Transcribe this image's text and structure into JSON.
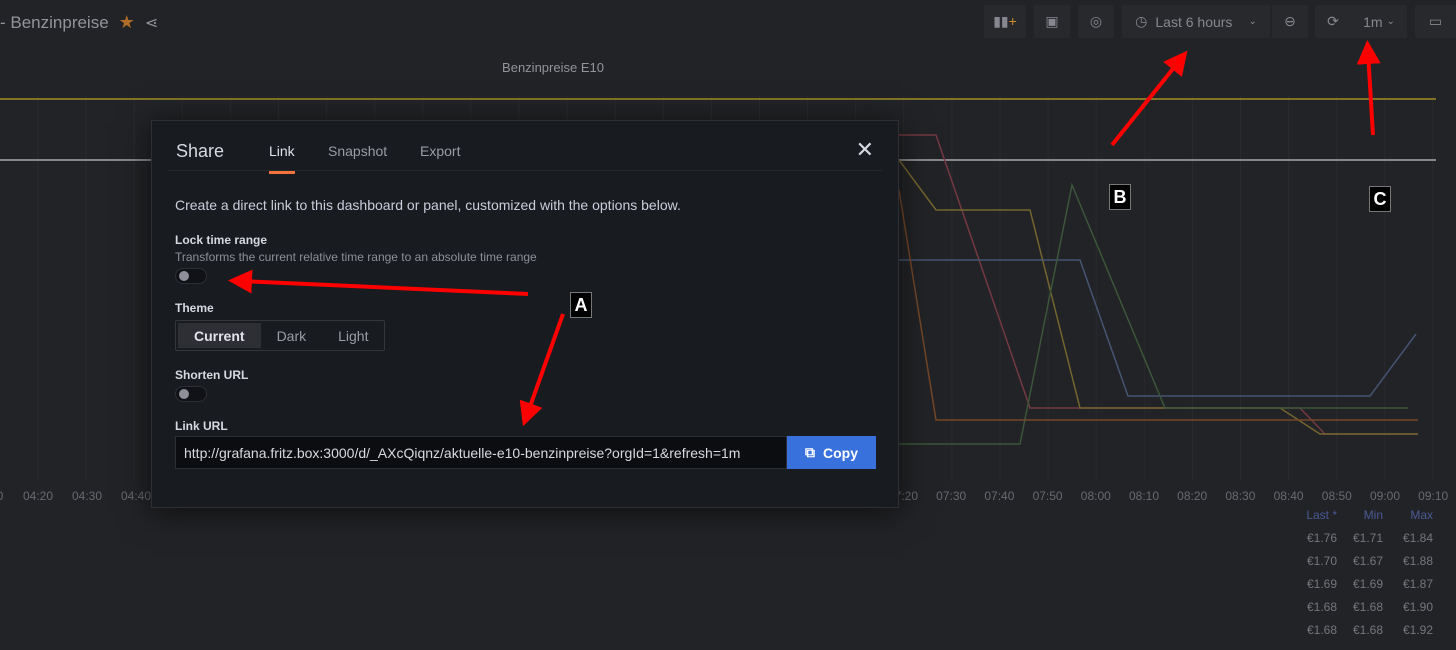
{
  "dashboard": {
    "title": "- Benzinpreise",
    "panel_title": "Benzinpreise E10"
  },
  "toolbar": {
    "time_range": "Last 6 hours",
    "refresh_interval": "1m"
  },
  "chart": {
    "x_ticks": [
      "0",
      "04:20",
      "04:30",
      "04:40",
      "07:20",
      "07:30",
      "07:40",
      "07:50",
      "08:00",
      "08:10",
      "08:20",
      "08:30",
      "08:40",
      "08:50",
      "09:00",
      "09:10"
    ],
    "legend_headers": [
      "Last *",
      "Min",
      "Max"
    ],
    "legend_rows": [
      [
        "€1.76",
        "€1.71",
        "€1.84"
      ],
      [
        "€1.70",
        "€1.67",
        "€1.88"
      ],
      [
        "€1.69",
        "€1.69",
        "€1.87"
      ],
      [
        "€1.68",
        "€1.68",
        "€1.90"
      ],
      [
        "€1.68",
        "€1.68",
        "€1.92"
      ]
    ]
  },
  "modal": {
    "title": "Share",
    "tabs": [
      "Link",
      "Snapshot",
      "Export"
    ],
    "active_tab": "Link",
    "intro": "Create a direct link to this dashboard or panel, customized with the options below.",
    "lock_label": "Lock time range",
    "lock_desc": "Transforms the current relative time range to an absolute time range",
    "lock_on": false,
    "theme_label": "Theme",
    "themes": [
      "Current",
      "Dark",
      "Light"
    ],
    "theme_selected": "Current",
    "shorten_label": "Shorten URL",
    "shorten_on": false,
    "link_label": "Link URL",
    "link_url": "http://grafana.fritz.box:3000/d/_AXcQiqnz/aktuelle-e10-benzinpreise?orgId=1&refresh=1m",
    "copy_label": "Copy"
  },
  "annotations": [
    "A",
    "B",
    "C"
  ],
  "colors": {
    "accent": "#f2733c",
    "primary": "#3871dc",
    "arrow": "#ff0000"
  }
}
